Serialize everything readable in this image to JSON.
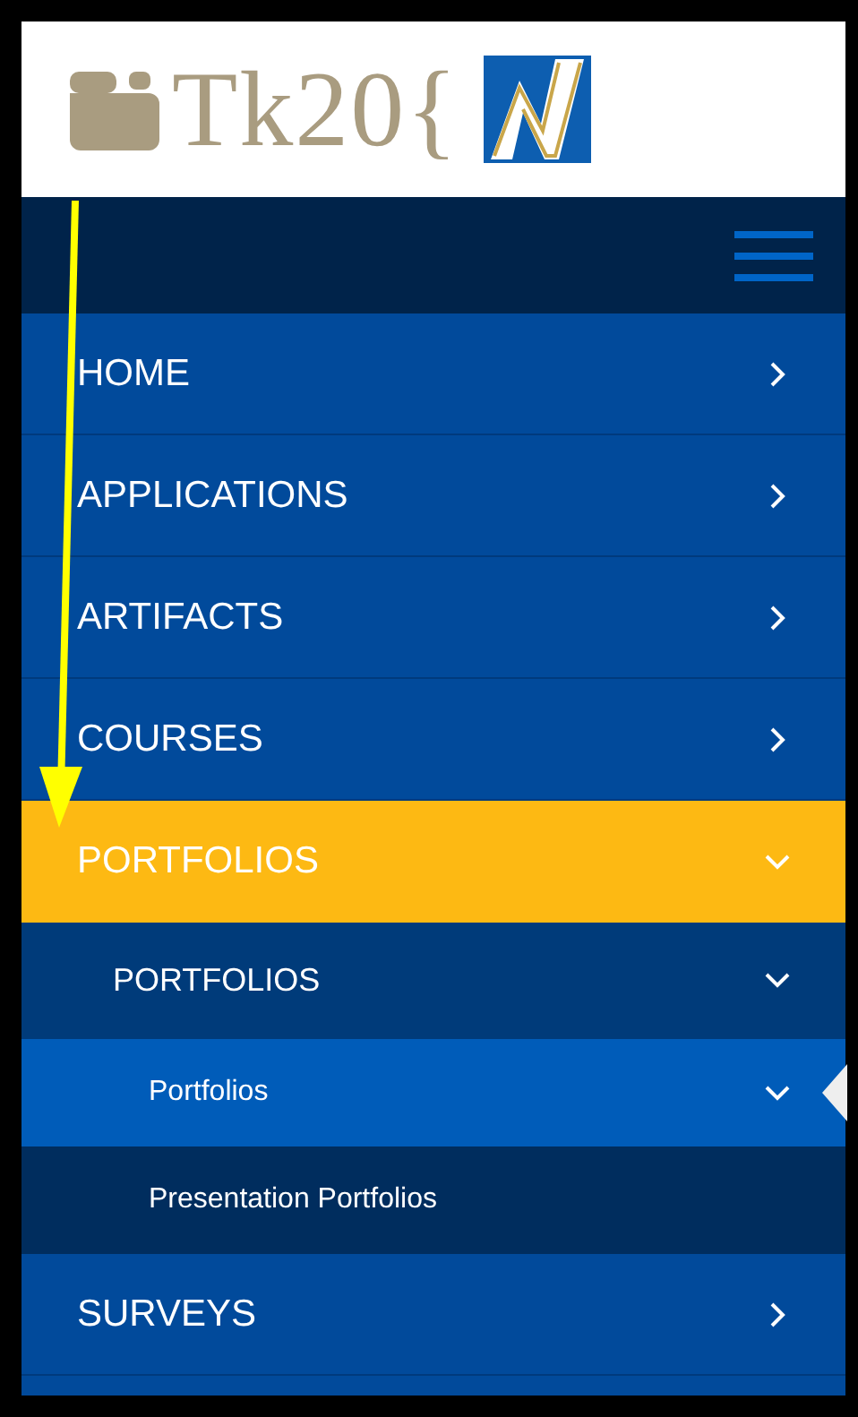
{
  "logo": {
    "text": "Tk20{"
  },
  "menu": [
    {
      "label": "HOME",
      "expanded": false,
      "selected": false
    },
    {
      "label": "APPLICATIONS",
      "expanded": false,
      "selected": false
    },
    {
      "label": "ARTIFACTS",
      "expanded": false,
      "selected": false
    },
    {
      "label": "COURSES",
      "expanded": false,
      "selected": false
    },
    {
      "label": "PORTFOLIOS",
      "expanded": true,
      "selected": true,
      "children": [
        {
          "label": "PORTFOLIOS",
          "expanded": true,
          "selected": false,
          "children": [
            {
              "label": "Portfolios",
              "expanded": true,
              "selected": true
            },
            {
              "label": "Presentation Portfolios",
              "selected": false
            }
          ]
        }
      ]
    },
    {
      "label": "SURVEYS",
      "expanded": false,
      "selected": false
    }
  ]
}
